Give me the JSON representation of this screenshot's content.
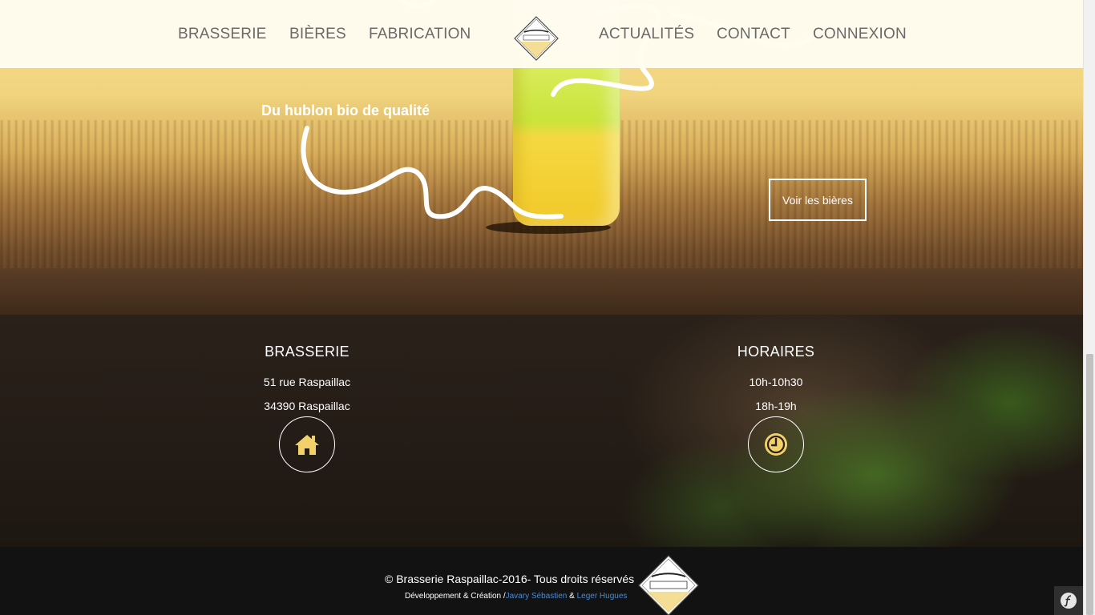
{
  "nav": {
    "items_left": [
      "BRASSERIE",
      "BIÈRES",
      "FABRICATION"
    ],
    "items_right": [
      "ACTUALITÉS",
      "CONTACT",
      "CONNEXION"
    ],
    "logo_icon": "raspaillac-logo"
  },
  "hero": {
    "tagline": "Du hublon bio de qualité",
    "button_label": "Voir les bières"
  },
  "info": {
    "brasserie": {
      "title": "BRASSERIE",
      "address_line1": "51 rue Raspaillac",
      "address_line2": "34390 Raspaillac",
      "icon": "home-icon"
    },
    "horaires": {
      "title": "HORAIRES",
      "line1": "10h-10h30",
      "line2": "18h-19h",
      "icon": "clock-icon"
    },
    "accent_color": "#f2d06a"
  },
  "footer": {
    "copyright": "© Brasserie Raspaillac-2016- Tous droits réservés",
    "credits_prefix": "Développement & Création /",
    "author1": "Javary Sébastien",
    "separator": " & ",
    "author2": "Leger Hugues",
    "link_color": "#4a8ad2"
  }
}
